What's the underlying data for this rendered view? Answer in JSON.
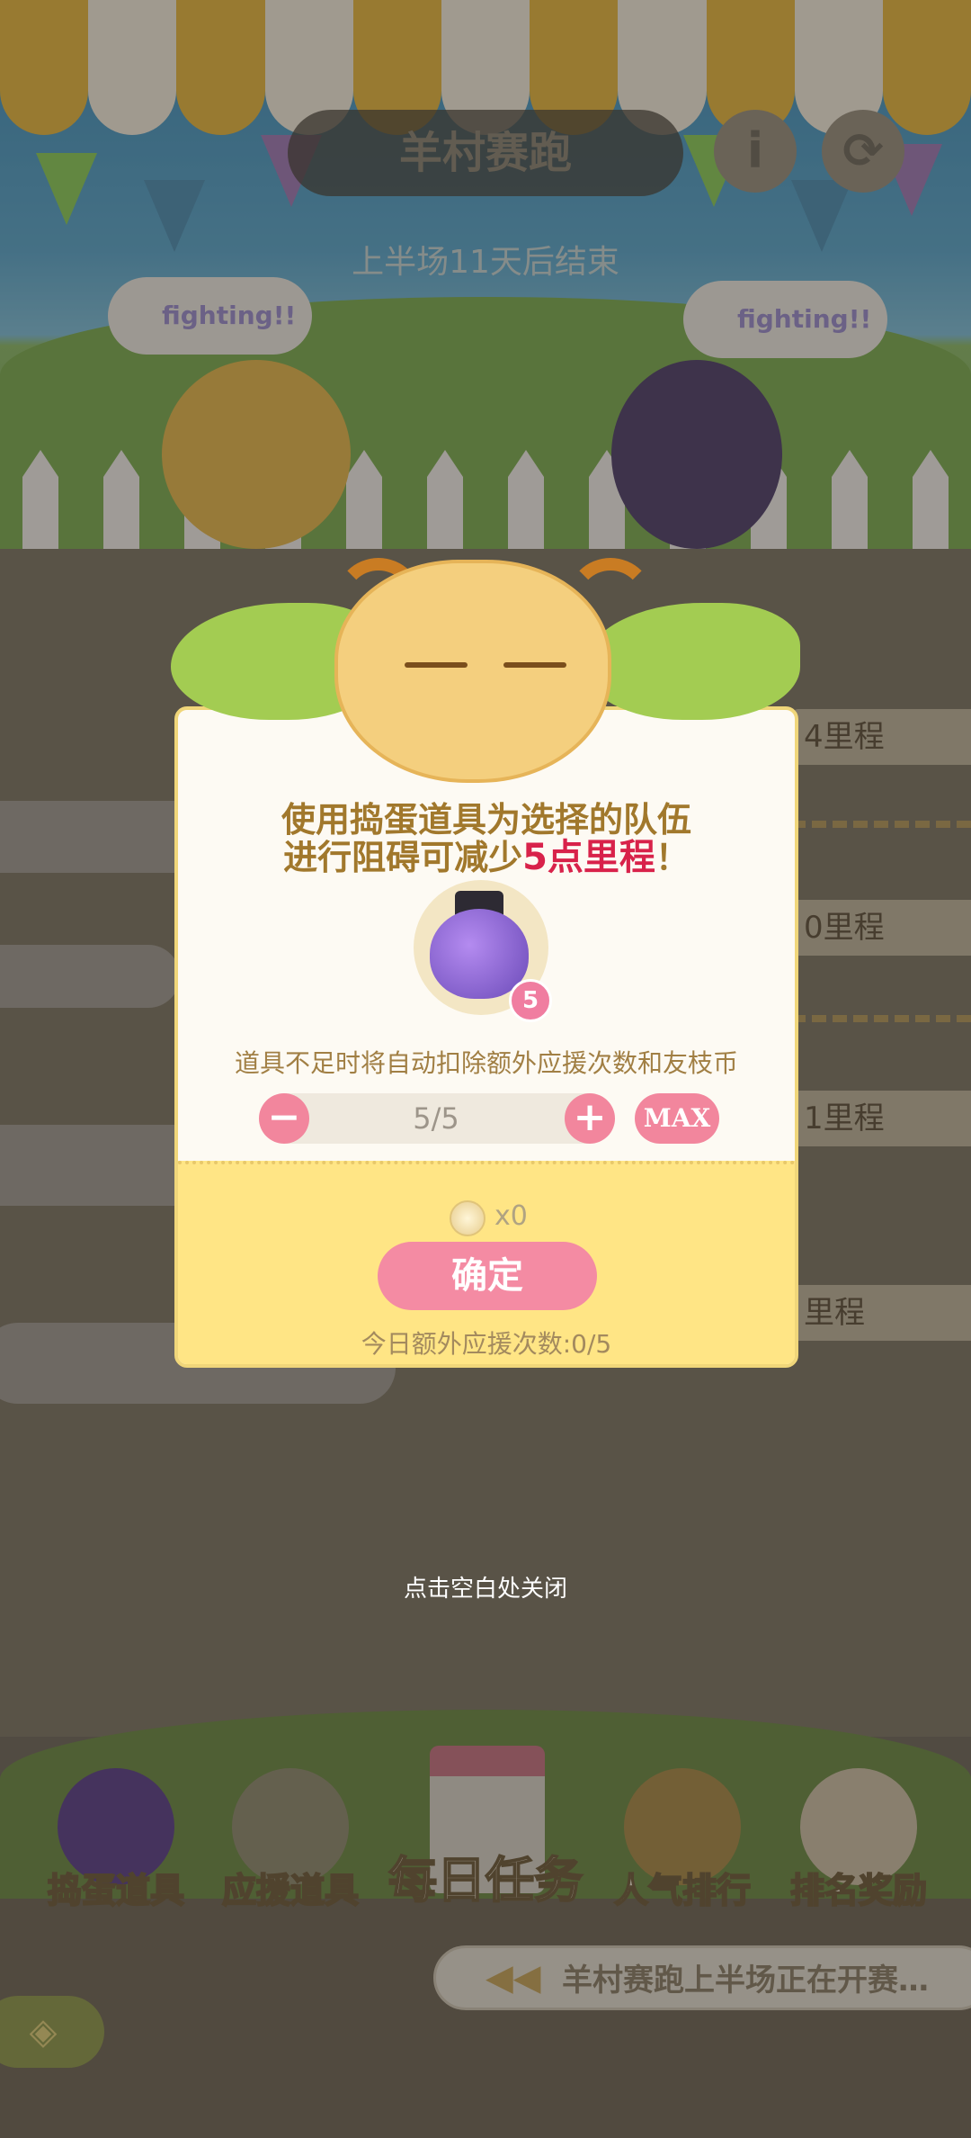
{
  "header": {
    "title": "羊村赛跑",
    "info_icon": "i",
    "refresh_icon": "⟳",
    "countdown": "上半场11天后结束",
    "bubble_left": "fighting!!",
    "bubble_right": "fighting!!"
  },
  "lanes": [
    "4里程",
    "0里程",
    "1里程",
    "里程"
  ],
  "dialog": {
    "line1": "使用捣蛋道具为选择的队伍",
    "line2_prefix": "进行阻碍可减少",
    "line2_highlight": "5点里程",
    "line2_suffix": "！",
    "item_count_badge": "5",
    "notice": "道具不足时将自动扣除额外应援次数和友枝币",
    "stepper": {
      "minus": "−",
      "value": "5/5",
      "plus": "+",
      "max": "MAX"
    },
    "coin_count": "x0",
    "confirm": "确定",
    "support_count": "今日额外应援次数:0/5"
  },
  "close_hint": "点击空白处关闭",
  "nav": {
    "items": [
      "捣蛋道具",
      "应援道具",
      "每日任务",
      "人气排行",
      "排名奖励"
    ]
  },
  "marquee": {
    "arrow": "◀◀",
    "text": "羊村赛跑上半场正在开赛…"
  },
  "back_icon": "◈",
  "colors": {
    "accent_pink": "#f48ba3",
    "highlight_red": "#d8224a",
    "dialog_yellow": "#ffe585"
  }
}
